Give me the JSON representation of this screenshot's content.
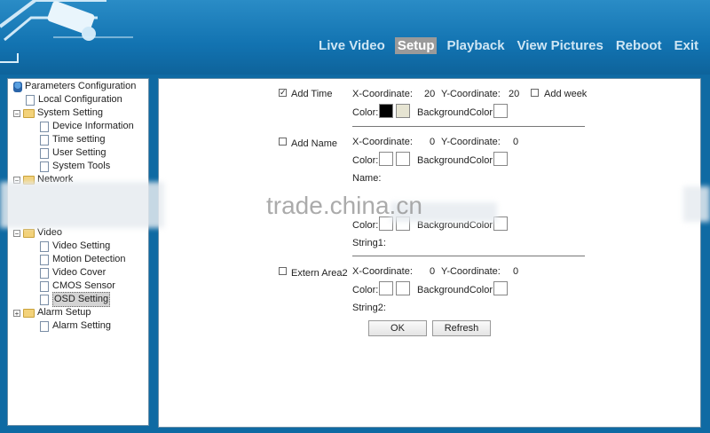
{
  "nav": {
    "items": [
      "Live Video",
      "Setup",
      "Playback",
      "View Pictures",
      "Reboot",
      "Exit"
    ],
    "active": "Setup"
  },
  "tree": {
    "root": "Parameters Configuration",
    "local": "Local Configuration",
    "system": "System Setting",
    "device_info": "Device Information",
    "time": "Time setting",
    "user": "User Setting",
    "tools": "System Tools",
    "network": "Network",
    "video": "Video",
    "video_setting": "Video Setting",
    "motion": "Motion Detection",
    "cover": "Video Cover",
    "cmos": "CMOS Sensor",
    "osd": "OSD Setting",
    "alarm": "Alarm Setup",
    "alarm_setting": "Alarm Setting"
  },
  "osd": {
    "add_time": {
      "label": "Add Time",
      "checked": true,
      "x_label": "X-Coordinate:",
      "x": "20",
      "y_label": "Y-Coordinate:",
      "y": "20",
      "add_week": "Add week",
      "color_label": "Color:",
      "bg_label": "BackgroundColor:"
    },
    "add_name": {
      "label": "Add Name",
      "checked": false,
      "x_label": "X-Coordinate:",
      "x": "0",
      "y_label": "Y-Coordinate:",
      "y": "0",
      "color_label": "Color:",
      "bg_label": "BackgroundColor:",
      "name_label": "Name:"
    },
    "area1": {
      "color_label": "Color:",
      "bg_label": "BackgroundColor:",
      "string_label": "String1:"
    },
    "area2": {
      "label": "Extern Area2",
      "checked": false,
      "x_label": "X-Coordinate:",
      "x": "0",
      "y_label": "Y-Coordinate:",
      "y": "0",
      "color_label": "Color:",
      "bg_label": "BackgroundColor:",
      "string_label": "String2:"
    },
    "ok": "OK",
    "refresh": "Refresh"
  },
  "colors": {
    "time_color": "#000000",
    "time_color2": "#e6e4d2"
  },
  "watermark": "trade.china.cn"
}
